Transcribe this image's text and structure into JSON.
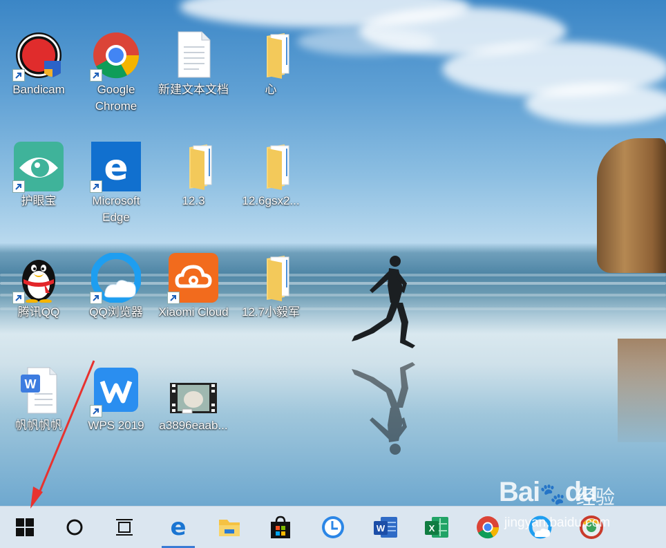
{
  "desktop": {
    "icons": [
      {
        "label": "Bandicam",
        "icon": "bandicam-icon"
      },
      {
        "label": "Google Chrome",
        "icon": "chrome-icon"
      },
      {
        "label": "新建文本文档",
        "icon": "text-document-icon"
      },
      {
        "label": "心",
        "icon": "folder-icon"
      },
      {
        "label": "护眼宝",
        "icon": "eye-protection-icon"
      },
      {
        "label": "Microsoft Edge",
        "icon": "edge-icon"
      },
      {
        "label": "12.3",
        "icon": "folder-icon"
      },
      {
        "label": "12.6gsx2...",
        "icon": "folder-icon"
      },
      {
        "label": "腾讯QQ",
        "icon": "qq-penguin-icon"
      },
      {
        "label": "QQ浏览器",
        "icon": "qq-browser-icon"
      },
      {
        "label": "Xiaomi Cloud",
        "icon": "xiaomi-cloud-icon"
      },
      {
        "label": "12.7小毅军",
        "icon": "folder-icon"
      },
      {
        "label": "帆帆帆帆",
        "icon": "word-document-icon"
      },
      {
        "label": "WPS 2019",
        "icon": "wps-icon"
      },
      {
        "label": "a3896eaab...",
        "icon": "video-thumbnail-icon"
      }
    ]
  },
  "taskbar": {
    "items": [
      {
        "name": "start",
        "icon": "windows-logo-icon"
      },
      {
        "name": "search",
        "icon": "cortana-circle-icon"
      },
      {
        "name": "task-view",
        "icon": "task-view-icon"
      },
      {
        "name": "edge",
        "icon": "edge-icon"
      },
      {
        "name": "file-explorer",
        "icon": "file-explorer-icon"
      },
      {
        "name": "store",
        "icon": "store-bag-icon"
      },
      {
        "name": "clock-app",
        "icon": "clock-icon"
      },
      {
        "name": "word",
        "icon": "word-icon"
      },
      {
        "name": "excel",
        "icon": "excel-icon"
      },
      {
        "name": "chrome",
        "icon": "chrome-icon"
      },
      {
        "name": "qq-browser",
        "icon": "qq-browser-icon"
      },
      {
        "name": "360-browser",
        "icon": "browser-icon"
      }
    ]
  },
  "watermark": {
    "brand": "Bai",
    "brand2": "du",
    "product": "经验",
    "url": "jingyan.baidu.com"
  },
  "colors": {
    "taskbar": "#dbe6f0",
    "accent": "#3a7bd5",
    "annotation_arrow": "#e8322f"
  }
}
